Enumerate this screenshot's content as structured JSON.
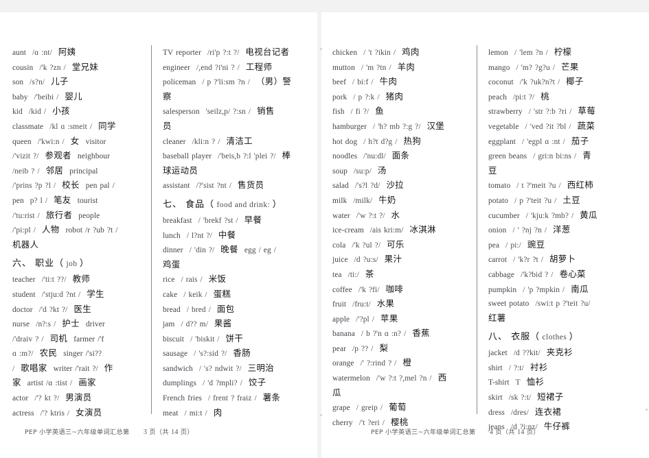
{
  "document": {
    "kind": "scanned-vocabulary-worksheet",
    "pages": [
      {
        "id": "page-3",
        "footer": {
          "prefix": "PEP  小学英语三~六年级单词汇总第",
          "page_number": "3",
          "suffix": "页（共",
          "total": "14",
          "suffix2": "页）"
        },
        "columns": [
          {
            "id": "col-1",
            "blocks": [
              {
                "type": "entry",
                "en": "aunt",
                "ipa": "/ɑ :nt/",
                "cn": "阿姨"
              },
              {
                "type": "entry",
                "en": "cousin",
                "ipa": "/'k  ?zn /",
                "cn": "堂兄妹"
              },
              {
                "type": "entry",
                "en": "son",
                "ipa": "/s?n/",
                "cn": "儿子"
              },
              {
                "type": "entry",
                "en": "baby",
                "ipa": "/'beibi /",
                "cn": "婴儿"
              },
              {
                "type": "entry",
                "en": "kid",
                "ipa": "/kid /",
                "cn": "小孩"
              },
              {
                "type": "entry",
                "en": "classmate",
                "ipa": "/kl  ɑ :smeit /",
                "cn": "同学"
              },
              {
                "type": "entry",
                "en": "queen",
                "ipa": "/'kwi:n /",
                "cn": "女",
                "tail_en": "visitor"
              },
              {
                "type": "entry",
                "ipa": "/'vizit ?/",
                "cn": "参观者",
                "tail_en": "neighbour"
              },
              {
                "type": "entry",
                "ipa": "/neib ? /",
                "cn": "邻居",
                "tail_en": "principal"
              },
              {
                "type": "entry",
                "ipa": "/'prins ?p ?l /",
                "cn": "校长",
                "tail_en": "pen pal /"
              },
              {
                "type": "entry",
                "en": "pen",
                "ipa": "p? l /",
                "cn": "笔友",
                "tail_en": "tourist"
              },
              {
                "type": "entry",
                "ipa": "/'tu:rist /",
                "cn": "旅行者",
                "tail_en": "people"
              },
              {
                "type": "entry",
                "ipa": "/'pi:pl /",
                "cn": "人物",
                "tail_en": "robot /r  ?ub  ?t /"
              },
              {
                "type": "entry",
                "cn": "机器人"
              },
              {
                "type": "section",
                "cn": "六、 职业（",
                "sub": "job",
                "cn2": "）"
              },
              {
                "type": "entry",
                "en": "teacher",
                "ipa": "/'ti:t  ??/",
                "cn": "教师"
              },
              {
                "type": "entry",
                "en": "student",
                "ipa": "/'stju:d  ?nt /",
                "cn": "学生"
              },
              {
                "type": "entry",
                "en": "doctor",
                "ipa": "/'d  ?kt  ?/",
                "cn": "医生"
              },
              {
                "type": "entry",
                "en": "nurse",
                "ipa": "/n?:s /",
                "cn": "护士",
                "tail_en": "driver"
              },
              {
                "type": "entry",
                "ipa": "/'draiv ? /",
                "cn": "司机",
                "tail_en": "farmer /'f"
              },
              {
                "type": "entry",
                "ipa": "ɑ :m?/",
                "cn": "农民",
                "tail_en": "singer  /'si??"
              },
              {
                "type": "entry",
                "ipa": "/",
                "cn": "歌唱家",
                "tail_en": "writer /'rait ?/",
                "cn2": "作"
              },
              {
                "type": "entry",
                "cn": "家",
                "tail_en": "artist /ɑ :tist /",
                "cn2": "画家"
              },
              {
                "type": "entry",
                "en": "actor",
                "ipa": "/'?  kt  ?/",
                "cn": "男演员"
              },
              {
                "type": "entry",
                "en": "actress",
                "ipa": "/'? ktris  /",
                "cn": "女演员"
              }
            ]
          },
          {
            "id": "col-2",
            "blocks": [
              {
                "type": "entry",
                "en": "TV reporter",
                "ipa": "/ri'p ?:t ?/",
                "cn": "电视台记者"
              },
              {
                "type": "entry",
                "en": "engineer",
                "ipa": "/,end ?i'ni ? /",
                "cn": "工程师"
              },
              {
                "type": "entry",
                "en": "policeman",
                "ipa": "/ p ?'li:sm ?n /",
                "cn": "（男）警"
              },
              {
                "type": "entry",
                "cn": "察"
              },
              {
                "type": "entry",
                "en": "salesperson",
                "ipa": "'seilz,p/ ?:sn /",
                "cn": "销售"
              },
              {
                "type": "entry",
                "cn": "员"
              },
              {
                "type": "entry",
                "en": "cleaner",
                "ipa": "/kli:n ? /",
                "cn": "清洁工"
              },
              {
                "type": "entry",
                "en": "baseball player",
                "ipa": "/'beis,b ?:l 'plei ?/",
                "cn": "棒"
              },
              {
                "type": "entry",
                "cn": "球运动员"
              },
              {
                "type": "entry",
                "en": "assistant",
                "ipa": "/?'sist ?nt /",
                "cn": "售货员"
              },
              {
                "type": "section",
                "cn": "七、 食品（",
                "sub": "food and drink:",
                "cn2": "）"
              },
              {
                "type": "entry",
                "en": "breakfast",
                "ipa": "/ 'brekf ?st /",
                "cn": "早餐"
              },
              {
                "type": "entry",
                "en": "lunch",
                "ipa": "/ l?nt ?/",
                "cn": "中餐"
              },
              {
                "type": "entry",
                "en": "dinner",
                "ipa": "/ 'din ?/",
                "cn": "晚餐",
                "tail_en": "egg / eg /"
              },
              {
                "type": "entry",
                "cn": "鸡蛋"
              },
              {
                "type": "entry",
                "en": "rice",
                "ipa": "/ rais /",
                "cn": "米饭"
              },
              {
                "type": "entry",
                "en": "cake",
                "ipa": "/ keik /",
                "cn": "蛋糕"
              },
              {
                "type": "entry",
                "en": "bread",
                "ipa": "/ bred /",
                "cn": "面包"
              },
              {
                "type": "entry",
                "en": "jam",
                "ipa": "/ d?? m/",
                "cn": "果酱"
              },
              {
                "type": "entry",
                "en": "biscuit",
                "ipa": "/ 'biskit /",
                "cn": "饼干"
              },
              {
                "type": "entry",
                "en": "sausage",
                "ipa": "/ 's?:sid ?/",
                "cn": "香肠"
              },
              {
                "type": "entry",
                "en": "sandwich",
                "ipa": "/ 's? ndwit ?/",
                "cn": "三明治"
              },
              {
                "type": "entry",
                "en": "dumplings",
                "ipa": "/ 'd ?mpli? /",
                "cn": "饺子"
              },
              {
                "type": "entry",
                "en": "French fries",
                "ipa": "/ frent ? fraiz /",
                "cn": "薯条"
              },
              {
                "type": "entry",
                "en": "meat",
                "ipa": "/ mi:t /",
                "cn": "肉"
              }
            ]
          }
        ]
      },
      {
        "id": "page-4",
        "footer": {
          "prefix": "PEP  小学英语三~六年级单词汇总第",
          "page_number": "4",
          "suffix": "页（共",
          "total": "14",
          "suffix2": "页）"
        },
        "columns": [
          {
            "id": "col-1",
            "blocks": [
              {
                "type": "entry",
                "en": "chicken",
                "ipa": "/ 't  ?ikin /",
                "cn": "鸡肉"
              },
              {
                "type": "entry",
                "en": "mutton",
                "ipa": "/ 'm  ?tn /",
                "cn": "羊肉"
              },
              {
                "type": "entry",
                "en": "beef",
                "ipa": "/ bi:f /",
                "cn": "牛肉"
              },
              {
                "type": "entry",
                "en": "pork",
                "ipa": "/ p ?:k /",
                "cn": "猪肉"
              },
              {
                "type": "entry",
                "en": "fish",
                "ipa": "/ fi ?/",
                "cn": "鱼"
              },
              {
                "type": "entry",
                "en": "hamburger",
                "ipa": "/ 'h? mb ?:g ?/",
                "cn": "汉堡"
              },
              {
                "type": "entry",
                "en": "hot dog",
                "ipa": "/ h?t  d?g /",
                "cn": "热狗"
              },
              {
                "type": "entry",
                "en": "noodles",
                "ipa": "/'nu:dl/",
                "cn": "面条"
              },
              {
                "type": "entry",
                "en": "soup",
                "ipa": "/su:p/",
                "cn": "汤"
              },
              {
                "type": "entry",
                "en": "salad",
                "ipa": "/'s?l  ?d/",
                "cn": "沙拉"
              },
              {
                "type": "entry",
                "en": "milk",
                "ipa": "/milk/",
                "cn": "牛奶"
              },
              {
                "type": "entry",
                "en": "water",
                "ipa": "/'w  ?:t ?/",
                "cn": "水"
              },
              {
                "type": "entry",
                "en": "ice-cream",
                "ipa": "/ais kri:m/",
                "cn": "冰淇淋"
              },
              {
                "type": "entry",
                "en": "cola",
                "ipa": "/'k  ?ul ?/",
                "cn": "可乐"
              },
              {
                "type": "entry",
                "en": "juice",
                "ipa": "/d  ?u:s/",
                "cn": "果汁"
              },
              {
                "type": "entry",
                "en": "tea",
                "ipa": "/ti:/",
                "cn": "茶"
              },
              {
                "type": "entry",
                "en": "coffee",
                "ipa": "/'k  ?fi/",
                "cn": "咖啡"
              },
              {
                "type": "entry",
                "en": "fruit",
                "ipa": "/fru:t/",
                "cn": "水果"
              },
              {
                "type": "entry",
                "en": "apple",
                "ipa": "/'?pl /",
                "cn": "苹果"
              },
              {
                "type": "entry",
                "en": "banana",
                "ipa": "/ b  ?'n ɑ :n? /",
                "cn": "香蕉"
              },
              {
                "type": "entry",
                "en": "pear",
                "ipa": "/p ?? /",
                "cn": "梨"
              },
              {
                "type": "entry",
                "en": "orange",
                "ipa": "/'  ?:rind  ? /",
                "cn": "橙"
              },
              {
                "type": "entry",
                "en": "watermelon",
                "ipa": "/'w  ?:t  ?,mel ?n /",
                "cn": "西"
              },
              {
                "type": "entry",
                "cn": "瓜"
              },
              {
                "type": "entry",
                "en": "grape",
                "ipa": "/ greip /",
                "cn": "葡萄"
              },
              {
                "type": "entry",
                "en": "cherry",
                "ipa": "/'t  ?eri /",
                "cn": "樱桃"
              }
            ]
          },
          {
            "id": "col-2",
            "blocks": [
              {
                "type": "entry",
                "en": "lemon",
                "ipa": "/ 'lem  ?n /",
                "cn": "柠檬"
              },
              {
                "type": "entry",
                "en": "mango",
                "ipa": "/ 'm? ?g?u /",
                "cn": "芒果"
              },
              {
                "type": "entry",
                "en": "coconut",
                "ipa": "/'k  ?uk?n?t /",
                "cn": "椰子"
              },
              {
                "type": "entry",
                "en": "peach",
                "ipa": "/pi:t  ?/",
                "cn": "桃"
              },
              {
                "type": "entry",
                "en": "strawberry",
                "ipa": "/ 'str  ?:b ?ri /",
                "cn": "草莓"
              },
              {
                "type": "entry",
                "en": "vegetable",
                "ipa": "/ 'ved  ?it ?bl /",
                "cn": "蔬菜"
              },
              {
                "type": "entry",
                "en": "eggplant",
                "ipa": "/ 'egpl  ɑ :nt /",
                "cn": "茄子"
              },
              {
                "type": "entry",
                "en": "green beans",
                "ipa": "/ gri:n bi:ns /",
                "cn": "青"
              },
              {
                "type": "entry",
                "cn": "豆"
              },
              {
                "type": "entry",
                "en": "tomato",
                "ipa": "/ t  ?'meit  ?u /",
                "cn": "西红柿"
              },
              {
                "type": "entry",
                "en": "potato",
                "ipa": "/ p  ?'teit  ?u /",
                "cn": "土豆"
              },
              {
                "type": "entry",
                "en": "cucumber",
                "ipa": "/ 'kju:k  ?mb? /",
                "cn": "黄瓜"
              },
              {
                "type": "entry",
                "en": "onion",
                "ipa": "/ '  ?nj ?n /",
                "cn": "洋葱"
              },
              {
                "type": "entry",
                "en": "pea",
                "ipa": "/ pi:/",
                "cn": "豌豆"
              },
              {
                "type": "entry",
                "en": "carrot",
                "ipa": "/ 'k?r  ?t /",
                "cn": "胡萝卜"
              },
              {
                "type": "entry",
                "en": "cabbage",
                "ipa": "/'k?bid  ? /",
                "cn": "卷心菜"
              },
              {
                "type": "entry",
                "en": "pumpkin",
                "ipa": "/ 'p  ?mpkin /",
                "cn": "南瓜"
              },
              {
                "type": "entry",
                "en": "sweet potato",
                "ipa": "/swi:t p  ?'teit  ?u/"
              },
              {
                "type": "entry",
                "cn": "红薯"
              },
              {
                "type": "section",
                "cn": "八、 衣服（",
                "sub": "clothes",
                "cn2": "）"
              },
              {
                "type": "entry",
                "en": "jacket",
                "ipa": "/d  ??kit/",
                "cn": "夹克衫"
              },
              {
                "type": "entry",
                "en": "shirt",
                "ipa": "/  ?:t/",
                "cn": "衬衫"
              },
              {
                "type": "entry",
                "en": "T-shirt",
                "ipa": "T",
                "cn": "恤衫"
              },
              {
                "type": "entry",
                "en": "skirt",
                "ipa": "/sk  ?:t/",
                "cn": "短裙子"
              },
              {
                "type": "entry",
                "en": "dress",
                "ipa": "/dres/",
                "cn": "连衣裙"
              },
              {
                "type": "entry",
                "en": "jeans",
                "ipa": "/d  ?i:nz/",
                "cn": "牛仔裤"
              }
            ]
          }
        ]
      }
    ]
  }
}
